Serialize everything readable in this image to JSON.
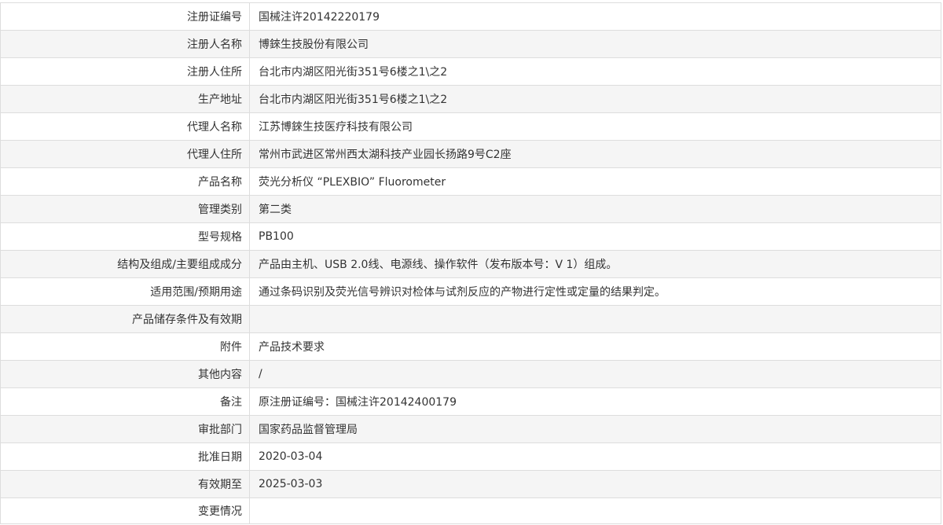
{
  "rows": [
    {
      "label": "注册证编号",
      "value": "国械注许20142220179"
    },
    {
      "label": "注册人名称",
      "value": "博錸生技股份有限公司"
    },
    {
      "label": "注册人住所",
      "value": "台北市内湖区阳光街351号6楼之1\\之2"
    },
    {
      "label": "生产地址",
      "value": "台北市内湖区阳光街351号6楼之1\\之2"
    },
    {
      "label": "代理人名称",
      "value": "江苏博錸生技医疗科技有限公司"
    },
    {
      "label": "代理人住所",
      "value": "常州市武进区常州西太湖科技产业园长扬路9号C2座"
    },
    {
      "label": "产品名称",
      "value": "荧光分析仪 “PLEXBIO” Fluorometer"
    },
    {
      "label": "管理类别",
      "value": "第二类"
    },
    {
      "label": "型号规格",
      "value": "PB100"
    },
    {
      "label": "结构及组成/主要组成成分",
      "value": "产品由主机、USB 2.0线、电源线、操作软件（发布版本号：V 1）组成。"
    },
    {
      "label": "适用范围/预期用途",
      "value": "通过条码识别及荧光信号辨识对检体与试剂反应的产物进行定性或定量的结果判定。"
    },
    {
      "label": "产品储存条件及有效期",
      "value": ""
    },
    {
      "label": "附件",
      "value": "产品技术要求"
    },
    {
      "label": "其他内容",
      "value": "/"
    },
    {
      "label": "备注",
      "value": "原注册证编号：国械注许20142400179"
    },
    {
      "label": "审批部门",
      "value": "国家药品监督管理局"
    },
    {
      "label": "批准日期",
      "value": "2020-03-04"
    },
    {
      "label": "有效期至",
      "value": "2025-03-03"
    },
    {
      "label": "变更情况",
      "value": ""
    }
  ]
}
